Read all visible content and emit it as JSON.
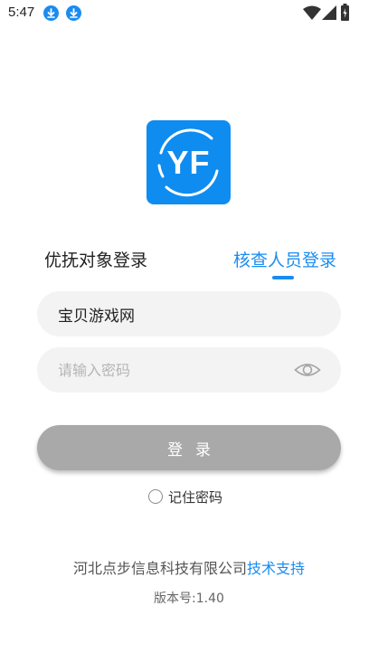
{
  "status_bar": {
    "time": "5:47",
    "icons": [
      "download-icon",
      "download-icon",
      "wifi-icon",
      "signal-icon",
      "battery-icon"
    ]
  },
  "logo": {
    "text": "YF",
    "color": "#0f8cf0"
  },
  "tabs": [
    {
      "label": "优抚对象登录",
      "active": false
    },
    {
      "label": "核查人员登录",
      "active": true
    }
  ],
  "form": {
    "username_value": "宝贝游戏网",
    "password_placeholder": "请输入密码",
    "login_label": "登录",
    "remember_label": "记住密码"
  },
  "footer": {
    "company": "河北点步信息科技有限公司",
    "support_link": "技术支持",
    "version": "版本号:1.40"
  },
  "colors": {
    "accent": "#1a8cf0",
    "button_disabled": "#a9a9a9",
    "input_bg": "#f3f3f3"
  }
}
